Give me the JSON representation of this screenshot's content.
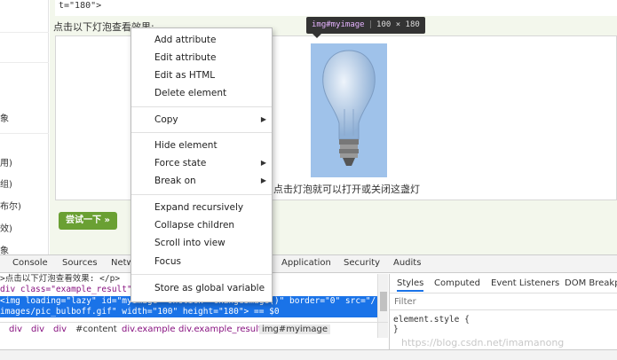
{
  "page": {
    "code_line": "t=\"180\">",
    "result_label": "点击以下灯泡查看效果:",
    "caption": "点击灯泡就可以打开或关闭这盏灯",
    "try_button": "尝试一下 »"
  },
  "left_fragments": [
    "象",
    "用)",
    "组)",
    "布尔)",
    "效)",
    "象"
  ],
  "tooltip": {
    "tag": "img#myimage",
    "dims": "100 × 180"
  },
  "context_menu": {
    "items": [
      {
        "label": "Add attribute",
        "submenu": false
      },
      {
        "label": "Edit attribute",
        "submenu": false
      },
      {
        "label": "Edit as HTML",
        "submenu": false
      },
      {
        "label": "Delete element",
        "submenu": false
      },
      {
        "label": "Copy",
        "submenu": true
      },
      {
        "label": "Hide element",
        "submenu": false
      },
      {
        "label": "Force state",
        "submenu": true
      },
      {
        "label": "Break on",
        "submenu": true
      },
      {
        "label": "Expand recursively",
        "submenu": false
      },
      {
        "label": "Collapse children",
        "submenu": false
      },
      {
        "label": "Scroll into view",
        "submenu": false
      },
      {
        "label": "Focus",
        "submenu": false
      },
      {
        "label": "Store as global variable",
        "submenu": false
      }
    ],
    "submenu_glyph": "▶"
  },
  "devtools": {
    "tabs": [
      "Console",
      "Sources",
      "Netw",
      "Application",
      "Security",
      "Audits"
    ],
    "elements": {
      "line1": ">点击以下灯泡查看效果: </p>",
      "line2": "div class=\"example_result\"",
      "line3": "<img loading=\"lazy\" id=\"myimage\" onclick=\"changeImage()\" border=\"0\" src=\"/",
      "line4": "images/pic_bulboff.gif\" width=\"100\" height=\"180\"> == $0"
    },
    "breadcrumbs": [
      "div",
      "div",
      "div",
      "#content",
      "div.example",
      "div.example_result",
      "img#myimage"
    ],
    "styles_tabs": [
      "Styles",
      "Computed",
      "Event Listeners",
      "DOM Breakpo"
    ],
    "filter_placeholder": "Filter",
    "style_rule_line1": "element.style {",
    "style_rule_line2": "}"
  },
  "watermark": "https://blog.csdn.net/imamanong",
  "colors": {
    "selection": "#1a73e8",
    "button_green": "#6aa033",
    "highlight": "#9fc2ea"
  }
}
